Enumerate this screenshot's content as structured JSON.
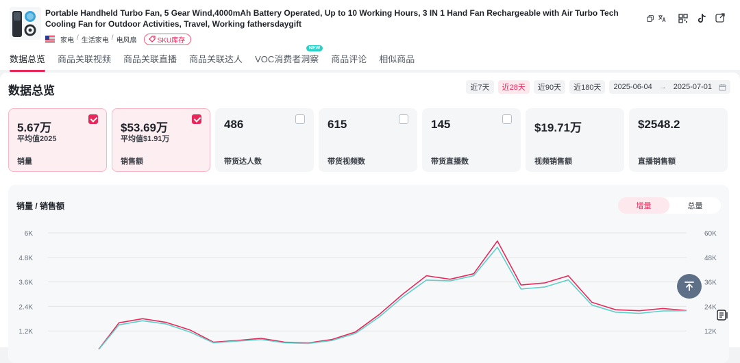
{
  "product": {
    "title": "Portable Handheld Turbo Fan, 5 Gear Wind,4000mAh Battery Operated, Up to 10 Working Hours, 3 IN 1 Hand Fan Rechargeable with Air Turbo Tech Cooling Fan for Outdoor Activities, Travel, Working fathersdaygift",
    "categories": [
      "家电",
      "生活家电",
      "电风扇"
    ],
    "sku_label": "SKU库存"
  },
  "tabs": [
    {
      "label": "数据总览",
      "active": true
    },
    {
      "label": "商品关联视频"
    },
    {
      "label": "商品关联直播"
    },
    {
      "label": "商品关联达人"
    },
    {
      "label": "VOC消费者洞察",
      "badge": "NEW"
    },
    {
      "label": "商品评论"
    },
    {
      "label": "相似商品"
    }
  ],
  "overview": {
    "title": "数据总览",
    "ranges": [
      {
        "label": "近7天"
      },
      {
        "label": "近28天",
        "active": true
      },
      {
        "label": "近90天"
      },
      {
        "label": "近180天"
      }
    ],
    "date_start": "2025-06-04",
    "date_end": "2025-07-01"
  },
  "cards": [
    {
      "value": "5.67万",
      "sub": "平均值2025",
      "label": "销量",
      "checked": true
    },
    {
      "value": "$53.69万",
      "sub": "平均值$1.91万",
      "label": "销售额",
      "checked": true
    },
    {
      "value": "486",
      "sub": "",
      "label": "带货达人数",
      "checked": false
    },
    {
      "value": "615",
      "sub": "",
      "label": "带货视频数",
      "checked": false
    },
    {
      "value": "145",
      "sub": "",
      "label": "带货直播数",
      "checked": false
    },
    {
      "value": "$19.71万",
      "sub": "",
      "label": "视频销售额",
      "checkbox": false
    },
    {
      "value": "$2548.2",
      "sub": "",
      "label": "直播销售额",
      "checkbox": false
    }
  ],
  "chart": {
    "title": "销量 / 销售额",
    "toggle": [
      {
        "label": "增量",
        "active": true
      },
      {
        "label": "总量"
      }
    ]
  },
  "chart_data": {
    "type": "line",
    "title": "销量 / 销售额",
    "y_left_ticks": [
      "1.2K",
      "2.4K",
      "3.6K",
      "4.8K",
      "6K"
    ],
    "y_right_ticks": [
      "12K",
      "24K",
      "36K",
      "48K",
      "60K"
    ],
    "ylim_left": [
      0,
      6000
    ],
    "ylim_right": [
      0,
      60000
    ],
    "grid": true,
    "series": [
      {
        "axis": "left",
        "color": "#e8285a",
        "values": [
          200,
          5,
          80,
          1600,
          1800,
          1620,
          1250,
          650,
          730,
          840,
          650,
          610,
          780,
          1150,
          2000,
          3000,
          3900,
          3730,
          4000,
          5600,
          3450,
          3550,
          3900,
          2600,
          2240,
          2190,
          2300,
          2200
        ]
      },
      {
        "axis": "right",
        "color": "#5fcfca",
        "values": [
          2000,
          50,
          800,
          15000,
          17000,
          15400,
          11500,
          6200,
          7000,
          7800,
          6200,
          5900,
          7300,
          10800,
          18800,
          28600,
          36900,
          36500,
          39000,
          53000,
          32500,
          33500,
          37000,
          24700,
          21200,
          20600,
          21800,
          21900
        ]
      }
    ]
  },
  "colors": {
    "accent": "#e8285a",
    "teal": "#5fcfca"
  }
}
